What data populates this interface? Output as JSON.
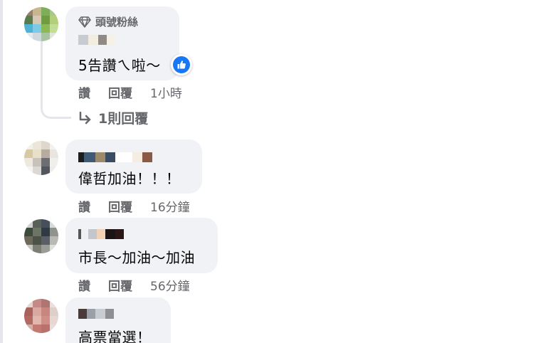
{
  "comments": [
    {
      "badge": "頭號粉絲",
      "text": "5告讚ㄟ啦～",
      "like_label": "讚",
      "reply_label": "回覆",
      "time": "1小時",
      "reaction": "like"
    },
    {
      "text": "偉哲加油！！！",
      "like_label": "讚",
      "reply_label": "回覆",
      "time": "16分鐘"
    },
    {
      "text": "市長～加油～加油",
      "like_label": "讚",
      "reply_label": "回覆",
      "time": "56分鐘"
    },
    {
      "text": "高票當選！"
    }
  ],
  "replies_link": "1則回覆",
  "icons": {
    "badge": "diamond-icon",
    "reaction": "thumbs-up-icon",
    "reply_arrow": "reply-arrow-icon"
  },
  "colors": {
    "bubble": "#f0f2f5",
    "secondary_text": "#65676b",
    "like_blue": "#1877f2"
  }
}
